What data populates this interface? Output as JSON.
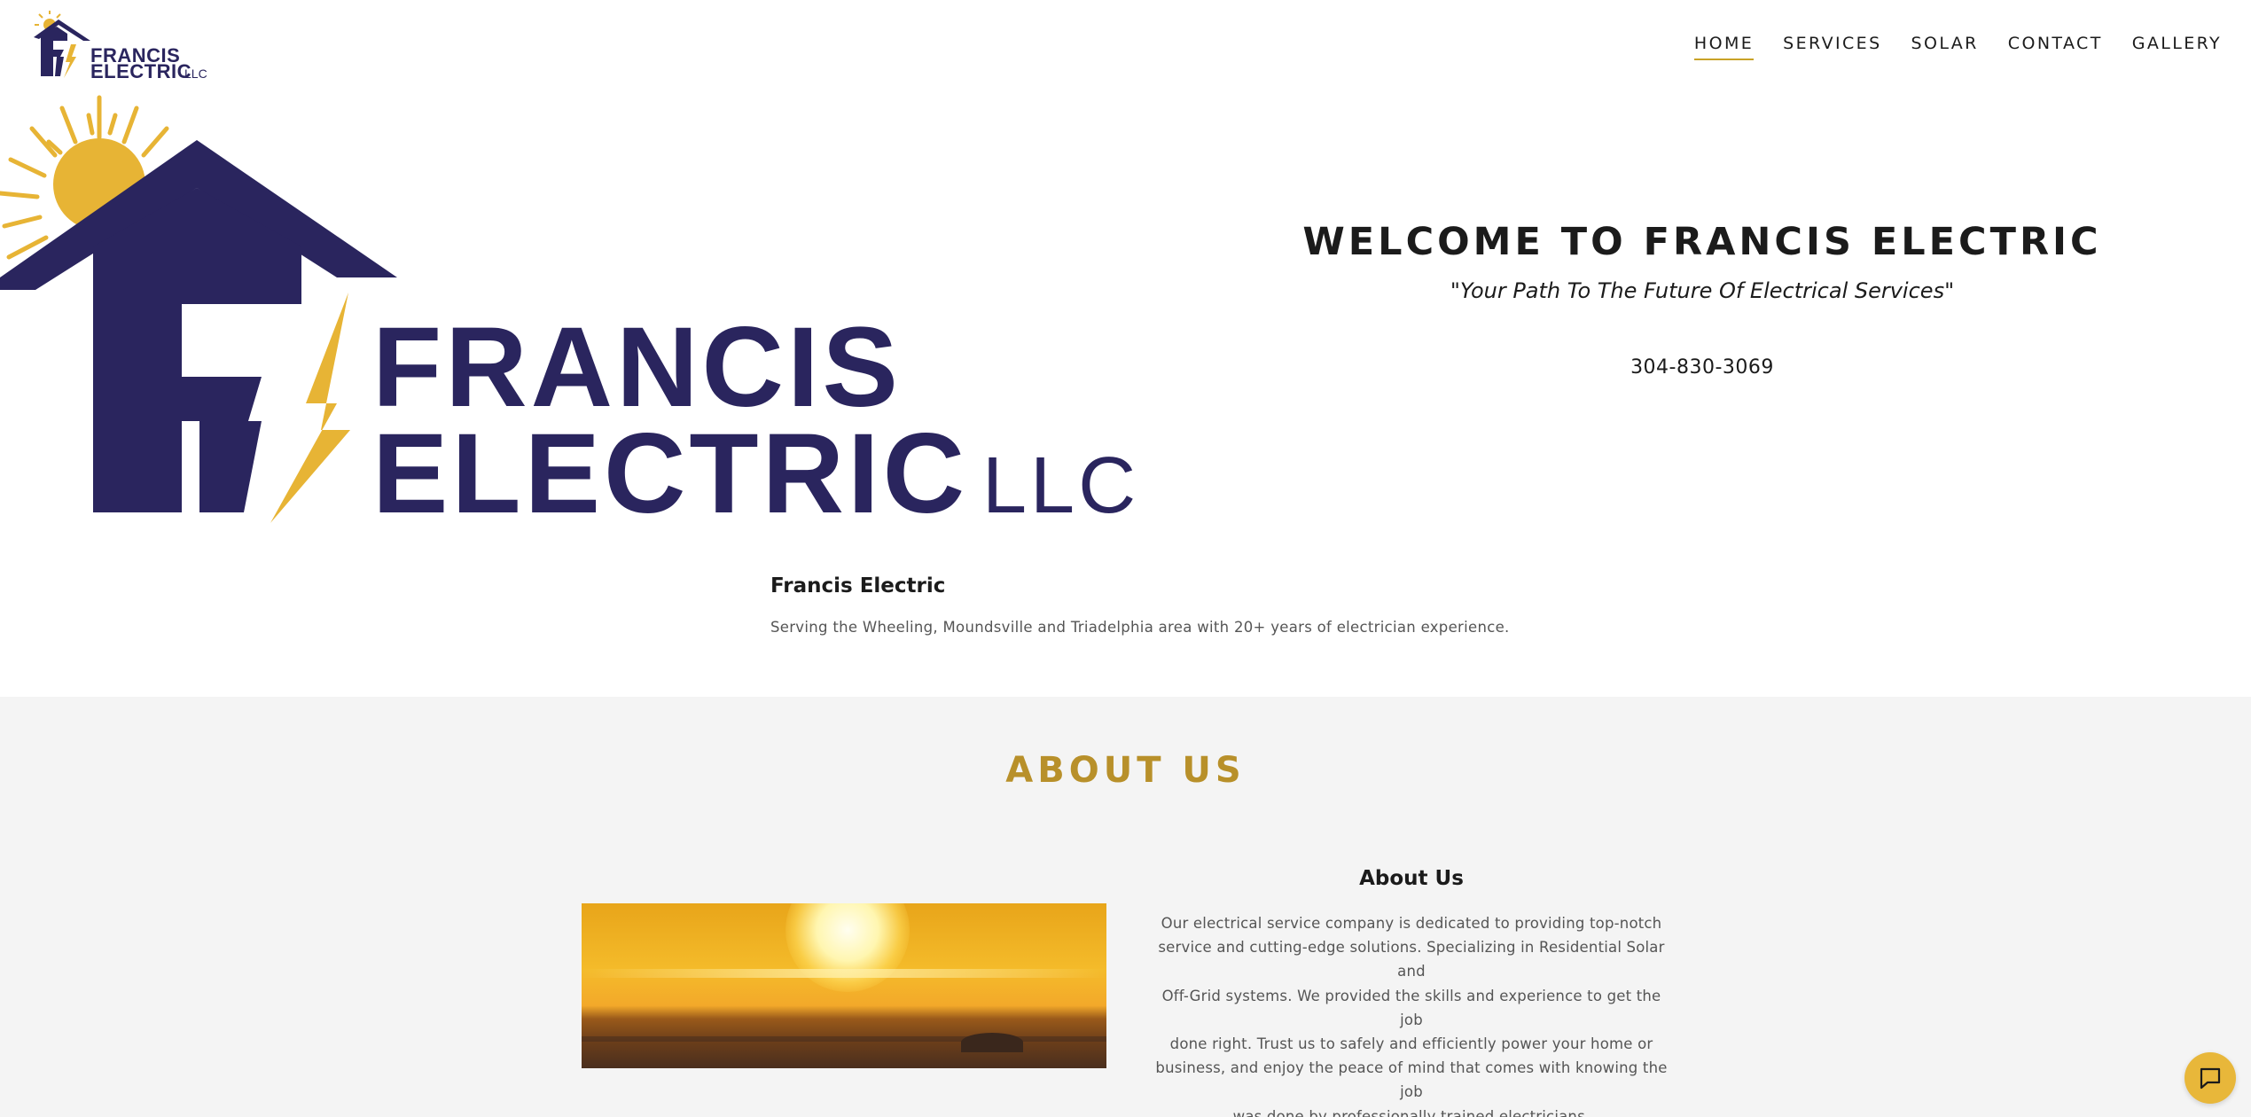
{
  "brand": {
    "name_line1": "FRANCIS",
    "name_line2": "ELECTRIC",
    "suffix": "LLC",
    "colors": {
      "navy": "#2a255e",
      "gold": "#e7b435",
      "accent_gold": "#b8902a"
    }
  },
  "nav": {
    "items": [
      {
        "label": "HOME",
        "active": true
      },
      {
        "label": "SERVICES",
        "active": false
      },
      {
        "label": "SOLAR",
        "active": false
      },
      {
        "label": "CONTACT",
        "active": false
      },
      {
        "label": "GALLERY",
        "active": false
      }
    ]
  },
  "welcome": {
    "title": "WELCOME TO FRANCIS ELECTRIC",
    "tagline": "\"Your Path To The Future Of Electrical Services\"",
    "phone": "304-830-3069"
  },
  "intro": {
    "title": "Francis Electric",
    "text": "Serving the Wheeling, Moundsville and Triadelphia area with 20+ years of electrician experience."
  },
  "about": {
    "heading": "ABOUT US",
    "subheading": "About Us",
    "paragraph_lines": [
      "Our electrical service company is dedicated to providing top-notch",
      "service and cutting-edge solutions.  Specializing in Residential Solar and",
      "Off-Grid  systems.  We provided the skills and experience to get the job",
      "done right.  Trust us to safely and efficiently power your home or",
      "business, and enjoy the peace of mind that comes with knowing the job",
      "was done by professionally trained electricians."
    ]
  },
  "chat": {
    "icon": "chat-bubble-icon"
  }
}
